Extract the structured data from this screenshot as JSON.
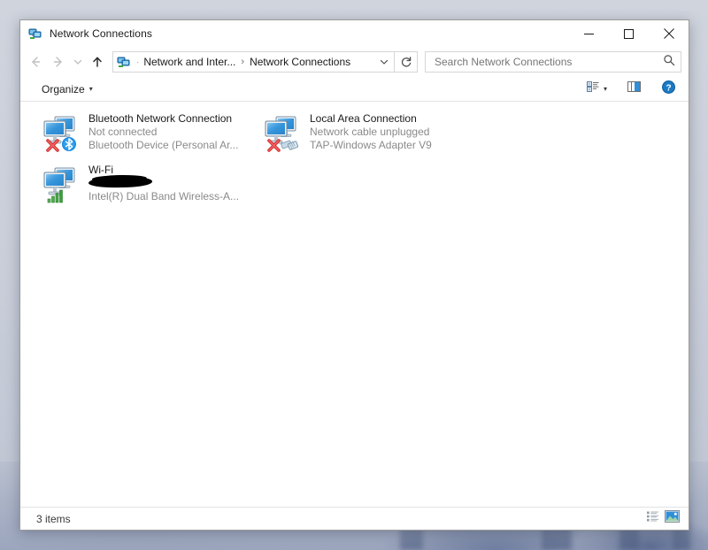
{
  "window": {
    "title": "Network Connections",
    "title_icon": "network-connections-icon",
    "buttons": {
      "minimize": "minimize-icon",
      "maximize": "maximize-icon",
      "close": "close-icon"
    }
  },
  "navigation": {
    "back": "back-arrow-icon",
    "forward": "forward-arrow-icon",
    "recent": "chevron-down-icon",
    "up": "up-arrow-icon",
    "refresh": "refresh-icon",
    "breadcrumb": {
      "icon": "network-connections-icon",
      "separator": "›",
      "dot_separator": "·",
      "items": [
        {
          "label": "Network and Inter..."
        },
        {
          "label": "Network Connections"
        }
      ],
      "dropdown": "chevron-down-icon"
    }
  },
  "search": {
    "placeholder": "Search Network Connections",
    "value": "",
    "icon": "search-icon"
  },
  "toolbar": {
    "organize_label": "Organize",
    "organize_caret": "▾",
    "view_options_icon": "change-view-icon",
    "view_options_caret": "▾",
    "preview_pane_icon": "preview-pane-icon",
    "help_icon": "help-icon"
  },
  "connections": [
    {
      "name": "Bluetooth Network Connection",
      "status": "Not connected",
      "device": "Bluetooth Device (Personal Ar...",
      "icon": "network-adapter-icon",
      "overlay": "red-x-icon",
      "badge": "bluetooth-icon",
      "redacted": false
    },
    {
      "name": "Local Area Connection",
      "status": "Network cable unplugged",
      "device": "TAP-Windows Adapter V9",
      "icon": "network-adapter-icon",
      "overlay": "red-x-icon",
      "badge": "ethernet-cable-icon",
      "redacted": false
    },
    {
      "name": "Wi-Fi",
      "status": "",
      "device": "Intel(R) Dual Band Wireless-A...",
      "icon": "network-adapter-icon",
      "overlay": "",
      "badge": "wifi-signal-icon",
      "redacted": true
    }
  ],
  "statusbar": {
    "item_count": "3 items",
    "details_view_icon": "details-view-icon",
    "large_icons_view_icon": "large-icons-view-icon"
  },
  "colors": {
    "accent": "#0078d7",
    "monitor_blue": "#2f8fd8",
    "red_x": "#d62f2f",
    "signal_green": "#3fa63f",
    "status_gray": "#8a8a8a",
    "close_hover": "#e81123"
  }
}
